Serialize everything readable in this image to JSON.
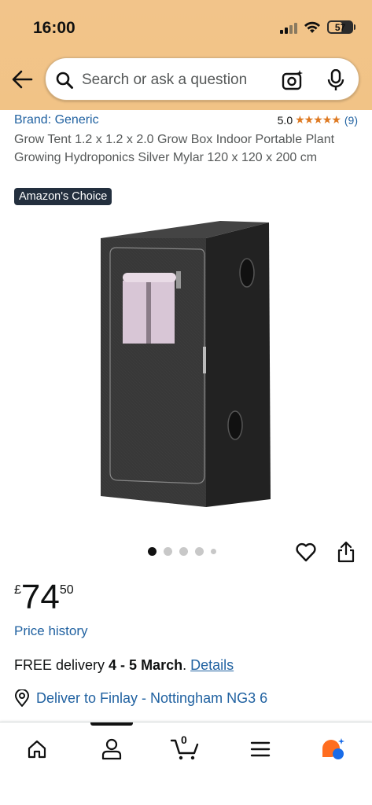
{
  "status_bar": {
    "time": "16:00",
    "battery": "57",
    "icons": [
      "signal-icon",
      "wifi-icon",
      "battery-icon"
    ]
  },
  "search": {
    "placeholder": "Search or ask a question",
    "icons": [
      "back-arrow-icon",
      "search-icon",
      "camera-icon",
      "mic-icon"
    ]
  },
  "product": {
    "brand": "Brand: Generic",
    "rating_value": "5.0",
    "rating_stars": "★★★★★",
    "rating_count": "(9)",
    "rating_out_of_5": 5.0,
    "title": "Grow Tent 1.2 x 1.2 x 2.0 Grow Box Indoor Portable Plant Growing Hydroponics Silver Mylar 120 x 120 x 200 cm",
    "badge": "Amazon's Choice",
    "image_count": 5,
    "active_image_index": 0
  },
  "price": {
    "symbol": "£",
    "whole": "74",
    "fraction": "50",
    "history_link": "Price history"
  },
  "delivery": {
    "prefix": "FREE delivery ",
    "dates": "4 - 5 March",
    "suffix": ". ",
    "details_link": "Details",
    "deliver_to": "Deliver to Finlay - Nottingham NG3 6"
  },
  "bottom_nav": {
    "cart_count": "0",
    "items": [
      "home-icon",
      "account-icon",
      "cart-icon",
      "menu-icon",
      "rufus-icon"
    ],
    "active": "account-icon"
  },
  "colors": {
    "header_bg": "#f2c48a",
    "link": "#2162a1",
    "star": "#de7921",
    "badge_bg": "#232f3e",
    "rufus_orange": "#ff6d1f",
    "rufus_blue": "#1a6ce8"
  }
}
